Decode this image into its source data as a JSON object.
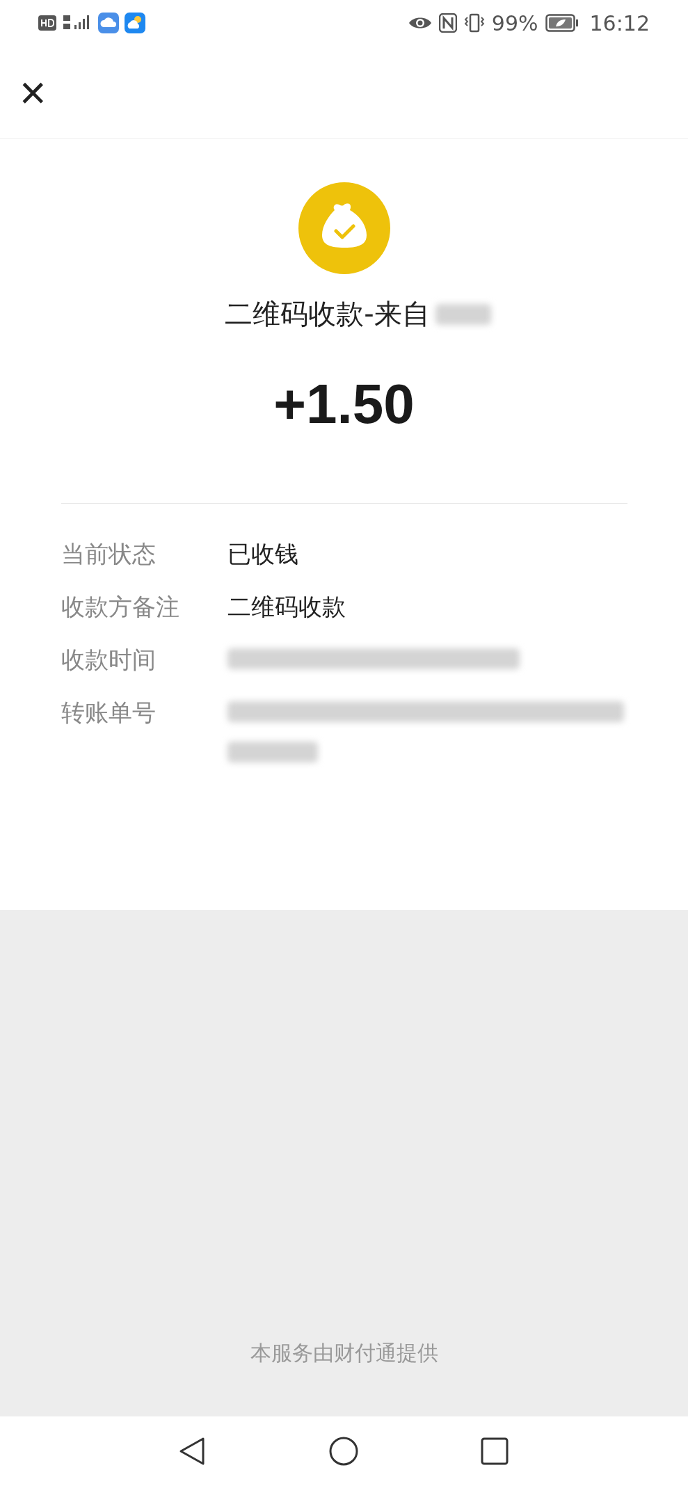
{
  "status_bar": {
    "battery": "99%",
    "time": "16:12"
  },
  "header": {
    "close": "×"
  },
  "receipt": {
    "title": "二维码收款-来自",
    "title_masked": true,
    "amount": "+1.50"
  },
  "details": [
    {
      "label": "当前状态",
      "value": "已收钱",
      "kind": "text"
    },
    {
      "label": "收款方备注",
      "value": "二维码收款",
      "kind": "text"
    },
    {
      "label": "收款时间",
      "kind": "masked"
    },
    {
      "label": "转账单号",
      "kind": "masked_wrapped"
    }
  ],
  "footer": "本服务由财付通提供"
}
